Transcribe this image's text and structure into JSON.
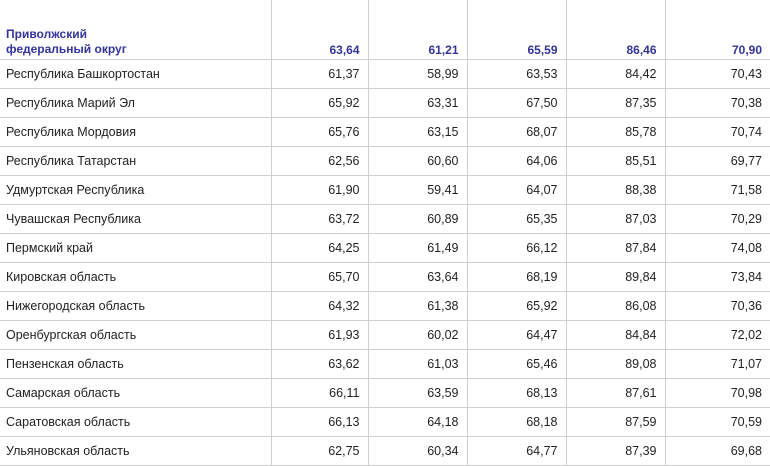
{
  "district": {
    "name_line1": "Приволжский",
    "name_line2": "федеральный округ",
    "values": [
      "63,64",
      "61,21",
      "65,59",
      "86,46",
      "70,90"
    ]
  },
  "rows": [
    {
      "name": "Республика Башкортостан",
      "values": [
        "61,37",
        "58,99",
        "63,53",
        "84,42",
        "70,43"
      ]
    },
    {
      "name": "Республика Марий Эл",
      "values": [
        "65,92",
        "63,31",
        "67,50",
        "87,35",
        "70,38"
      ]
    },
    {
      "name": "Республика Мордовия",
      "values": [
        "65,76",
        "63,15",
        "68,07",
        "85,78",
        "70,74"
      ]
    },
    {
      "name": "Республика Татарстан",
      "values": [
        "62,56",
        "60,60",
        "64,06",
        "85,51",
        "69,77"
      ]
    },
    {
      "name": "Удмуртская Республика",
      "values": [
        "61,90",
        "59,41",
        "64,07",
        "88,38",
        "71,58"
      ]
    },
    {
      "name": "Чувашская Республика",
      "values": [
        "63,72",
        "60,89",
        "65,35",
        "87,03",
        "70,29"
      ]
    },
    {
      "name": "Пермский край",
      "values": [
        "64,25",
        "61,49",
        "66,12",
        "87,84",
        "74,08"
      ]
    },
    {
      "name": "Кировская область",
      "values": [
        "65,70",
        "63,64",
        "68,19",
        "89,84",
        "73,84"
      ]
    },
    {
      "name": "Нижегородская область",
      "values": [
        "64,32",
        "61,38",
        "65,92",
        "86,08",
        "70,36"
      ]
    },
    {
      "name": "Оренбургская область",
      "values": [
        "61,93",
        "60,02",
        "64,47",
        "84,84",
        "72,02"
      ]
    },
    {
      "name": "Пензенская область",
      "values": [
        "63,62",
        "61,03",
        "65,46",
        "89,08",
        "71,07"
      ]
    },
    {
      "name": "Самарская область",
      "values": [
        "66,11",
        "63,59",
        "68,13",
        "87,61",
        "70,98"
      ]
    },
    {
      "name": "Саратовская область",
      "values": [
        "66,13",
        "64,18",
        "68,18",
        "87,59",
        "70,59"
      ]
    },
    {
      "name": "Ульяновская область",
      "values": [
        "62,75",
        "60,34",
        "64,77",
        "87,39",
        "69,68"
      ]
    }
  ],
  "colors": {
    "district_text": "#333399",
    "body_text": "#222222",
    "grid": "#cfcfcf"
  }
}
